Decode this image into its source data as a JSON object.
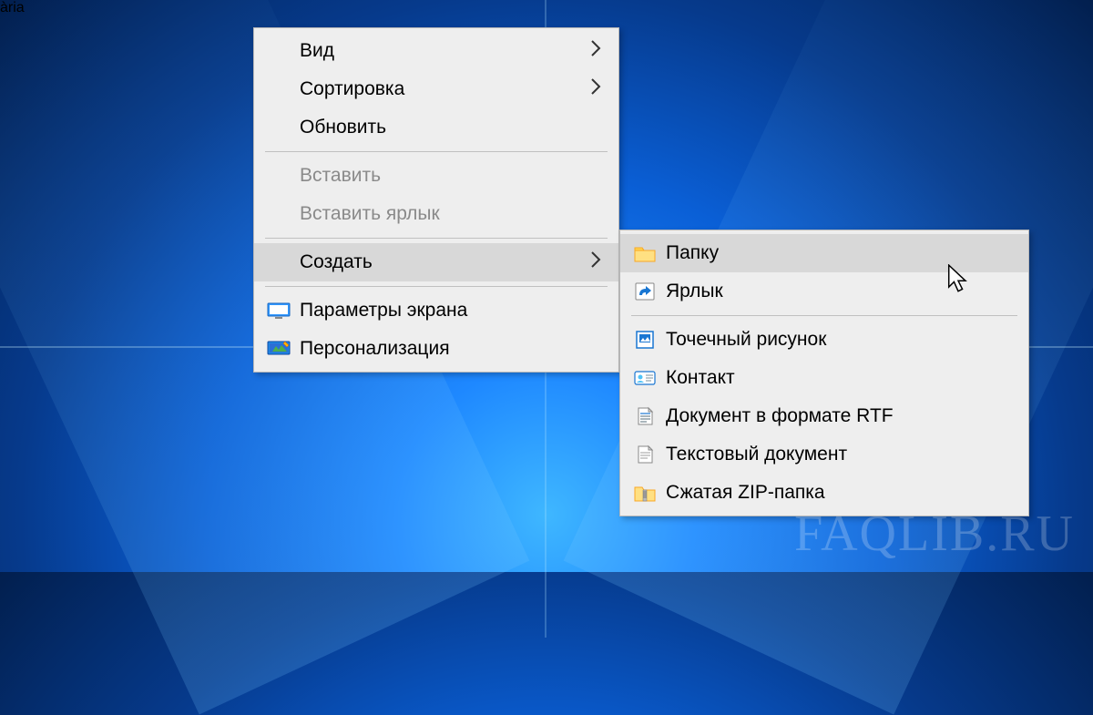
{
  "watermark": "FAQLIB.RU",
  "main_menu": {
    "view": "Вид",
    "sort": "Сортировка",
    "refresh": "Обновить",
    "paste": "Вставить",
    "paste_shortcut": "Вставить ярлык",
    "create": "Создать",
    "display_params": "Параметры экрана",
    "personalize": "Персонализация"
  },
  "submenu": {
    "folder": "Папку",
    "shortcut": "Ярлык",
    "bitmap": "Точечный рисунок",
    "contact": "Контакт",
    "rtf": "Документ в формате RTF",
    "text": "Текстовый документ",
    "zip": "Сжатая ZIP-папка"
  }
}
